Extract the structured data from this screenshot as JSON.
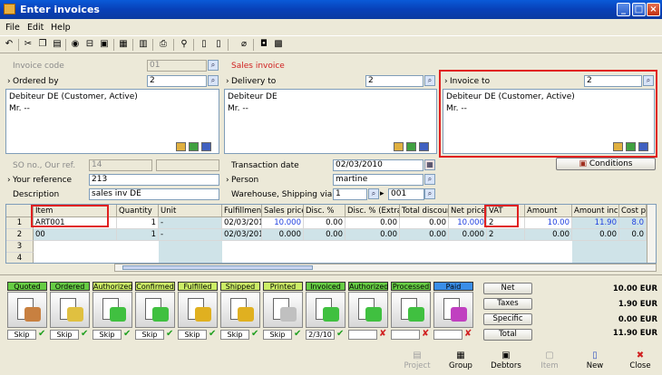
{
  "window": {
    "title": "Enter invoices"
  },
  "menu": [
    "File",
    "Edit",
    "Help"
  ],
  "header": {
    "invoice_code_label": "Invoice code",
    "invoice_code_value": "01",
    "sales_invoice_label": "Sales invoice",
    "ordered_by_label": "Ordered by",
    "ordered_by_value": "2",
    "delivery_to_label": "Delivery to",
    "delivery_to_value": "2",
    "invoice_to_label": "Invoice to",
    "invoice_to_value": "2",
    "ordered_by_address": [
      "Debiteur DE (Customer, Active)",
      "Mr. --"
    ],
    "delivery_address": [
      "Debiteur DE",
      "Mr. --"
    ],
    "invoice_address": [
      "Debiteur DE (Customer, Active)",
      "Mr. --"
    ],
    "so_label": "SO no., Our ref.",
    "so_value": "14",
    "your_reference_label": "Your reference",
    "your_reference_value": "213",
    "description_label": "Description",
    "description_value": "sales inv DE",
    "transaction_date_label": "Transaction date",
    "transaction_date_value": "02/03/2010",
    "person_label": "Person",
    "person_value": "martine",
    "warehouse_label": "Warehouse, Shipping via",
    "warehouse_value": "1",
    "shipping_value": "001",
    "conditions_button": "Conditions"
  },
  "grid": {
    "columns": [
      "Item",
      "Quantity",
      "Unit",
      "Fulfillment",
      "Sales price",
      "Disc. %",
      "Disc. % (Extra)",
      "Total discount",
      "Net price",
      "VAT",
      "Amount",
      "Amount incl",
      "Cost price"
    ],
    "rows": [
      {
        "n": "1",
        "item": "ART001",
        "qty": "1",
        "unit": "-",
        "date": "02/03/2010",
        "sales": "10.000",
        "disc": "0.00",
        "disc2": "0.00",
        "total": "0.00",
        "net": "10.000",
        "vat": "2",
        "amount": "10.00",
        "incl": "11.90",
        "cost": "8.0"
      },
      {
        "n": "2",
        "item": "00",
        "qty": "1",
        "unit": "-",
        "date": "02/03/2010",
        "sales": "0.000",
        "disc": "0.00",
        "disc2": "0.00",
        "total": "0.00",
        "net": "0.000",
        "vat": "2",
        "amount": "0.00",
        "incl": "0.00",
        "cost": "0.0"
      },
      {
        "n": "3"
      },
      {
        "n": "4"
      }
    ]
  },
  "stages": [
    {
      "label": "Quoted",
      "color": "#66cc44",
      "skip": "Skip",
      "status": "check"
    },
    {
      "label": "Ordered",
      "color": "#66cc44",
      "skip": "Skip",
      "status": "check"
    },
    {
      "label": "Authorized",
      "color": "#ccee66",
      "skip": "Skip",
      "status": "check"
    },
    {
      "label": "Confirmed",
      "color": "#ccee66",
      "skip": "Skip",
      "status": "check"
    },
    {
      "label": "Fulfilled",
      "color": "#ccee66",
      "skip": "Skip",
      "status": "check"
    },
    {
      "label": "Shipped",
      "color": "#ccee66",
      "skip": "Skip",
      "status": "check"
    },
    {
      "label": "Printed",
      "color": "#ccee66",
      "skip": "Skip",
      "status": "check"
    },
    {
      "label": "Invoiced",
      "color": "#66cc44",
      "skip": "2/3/10",
      "status": "check"
    },
    {
      "label": "Authorized",
      "color": "#66cc44",
      "skip": "",
      "status": "cross"
    },
    {
      "label": "Processed",
      "color": "#66cc44",
      "skip": "",
      "status": "cross"
    },
    {
      "label": "Paid",
      "color": "#3a8ee8",
      "skip": "",
      "status": "cross"
    }
  ],
  "summary": {
    "buttons": [
      "Net",
      "Taxes",
      "Specific",
      "Total"
    ],
    "values": [
      "10.00 EUR",
      "1.90 EUR",
      "0.00 EUR",
      "11.90 EUR"
    ]
  },
  "bottom_buttons": [
    {
      "label": "Project",
      "icon": "project-icon",
      "enabled": false
    },
    {
      "label": "Group",
      "icon": "group-icon",
      "enabled": true
    },
    {
      "label": "Debtors",
      "icon": "debtors-icon",
      "enabled": true
    },
    {
      "label": "Item",
      "icon": "item-icon",
      "enabled": false
    },
    {
      "label": "New",
      "icon": "new-icon",
      "enabled": true
    },
    {
      "label": "Close",
      "icon": "close-icon",
      "enabled": true
    }
  ],
  "colors": {
    "highlight_red": "#e02020",
    "sales_invoice": "#d02020",
    "blue_value": "#2040e0"
  }
}
